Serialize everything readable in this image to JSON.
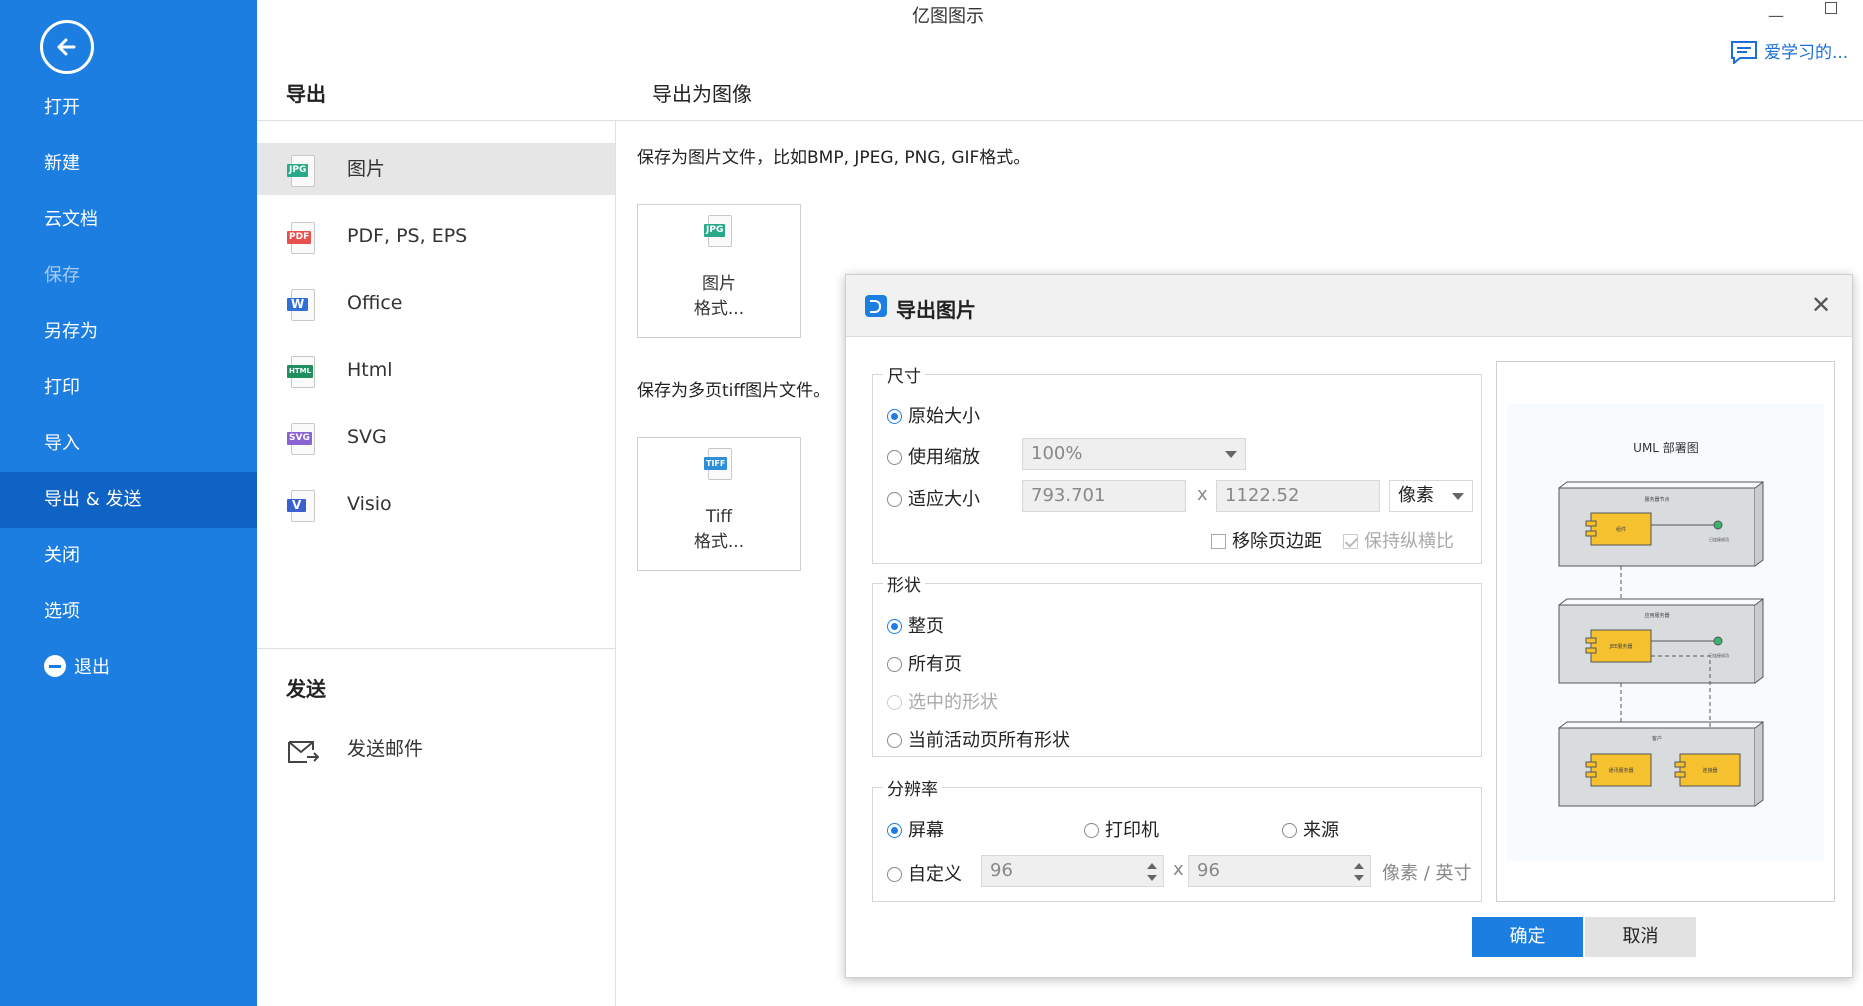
{
  "window": {
    "title": "亿图图示",
    "learn_link": "爱学习的..."
  },
  "sidebar": {
    "items": [
      {
        "label": "打开"
      },
      {
        "label": "新建"
      },
      {
        "label": "云文档"
      },
      {
        "label": "保存"
      },
      {
        "label": "另存为"
      },
      {
        "label": "打印"
      },
      {
        "label": "导入"
      },
      {
        "label": "导出 & 发送"
      },
      {
        "label": "关闭"
      },
      {
        "label": "选项"
      },
      {
        "label": "退出"
      }
    ]
  },
  "export": {
    "title": "导出",
    "formats": [
      {
        "label": "图片",
        "tag": "JPG",
        "color": "#27a98a"
      },
      {
        "label": "PDF, PS, EPS",
        "tag": "PDF",
        "color": "#e8504f"
      },
      {
        "label": "Office",
        "tag": "W",
        "color": "#2f6fd6"
      },
      {
        "label": "Html",
        "tag": "HTML",
        "color": "#1f8f5f"
      },
      {
        "label": "SVG",
        "tag": "SVG",
        "color": "#8a63d2"
      },
      {
        "label": "Visio",
        "tag": "V",
        "color": "#3a5fcf"
      }
    ]
  },
  "send": {
    "title": "发送",
    "email_label": "发送邮件"
  },
  "main": {
    "title": "导出为图像",
    "desc_image": "保存为图片文件，比如BMP, JPEG, PNG, GIF格式。",
    "card_image": {
      "tag": "JPG",
      "line1": "图片",
      "line2": "格式..."
    },
    "desc_tiff": "保存为多页tiff图片文件。",
    "card_tiff": {
      "tag": "TIFF",
      "line1": "Tiff",
      "line2": "格式..."
    }
  },
  "dialog": {
    "title": "导出图片",
    "size": {
      "label": "尺寸",
      "original": "原始大小",
      "zoom": "使用缩放",
      "zoom_value": "100%",
      "fit": "适应大小",
      "width": "793.701",
      "x_sep": "x",
      "height": "1122.52",
      "unit": "像素",
      "remove_margin": "移除页边距",
      "keep_ratio": "保持纵横比"
    },
    "shape": {
      "label": "形状",
      "whole_page": "整页",
      "all_pages": "所有页",
      "selected": "选中的形状",
      "active_page": "当前活动页所有形状"
    },
    "resolution": {
      "label": "分辨率",
      "screen": "屏幕",
      "printer": "打印机",
      "source": "来源",
      "custom": "自定义",
      "dpi_x": "96",
      "x_sep": "x",
      "dpi_y": "96",
      "unit": "像素 / 英寸"
    },
    "preview": {
      "title": "UML 部署图",
      "boxes": [
        {
          "node": "服务器节点",
          "component": "组件",
          "status": "已连接成功"
        },
        {
          "node": "应用服务器",
          "component": "JEE服务器",
          "status": "已连接成功"
        },
        {
          "node": "客户",
          "component_left": "通讯服务器",
          "component_right": "连接器"
        }
      ]
    },
    "ok": "确定",
    "cancel": "取消"
  }
}
